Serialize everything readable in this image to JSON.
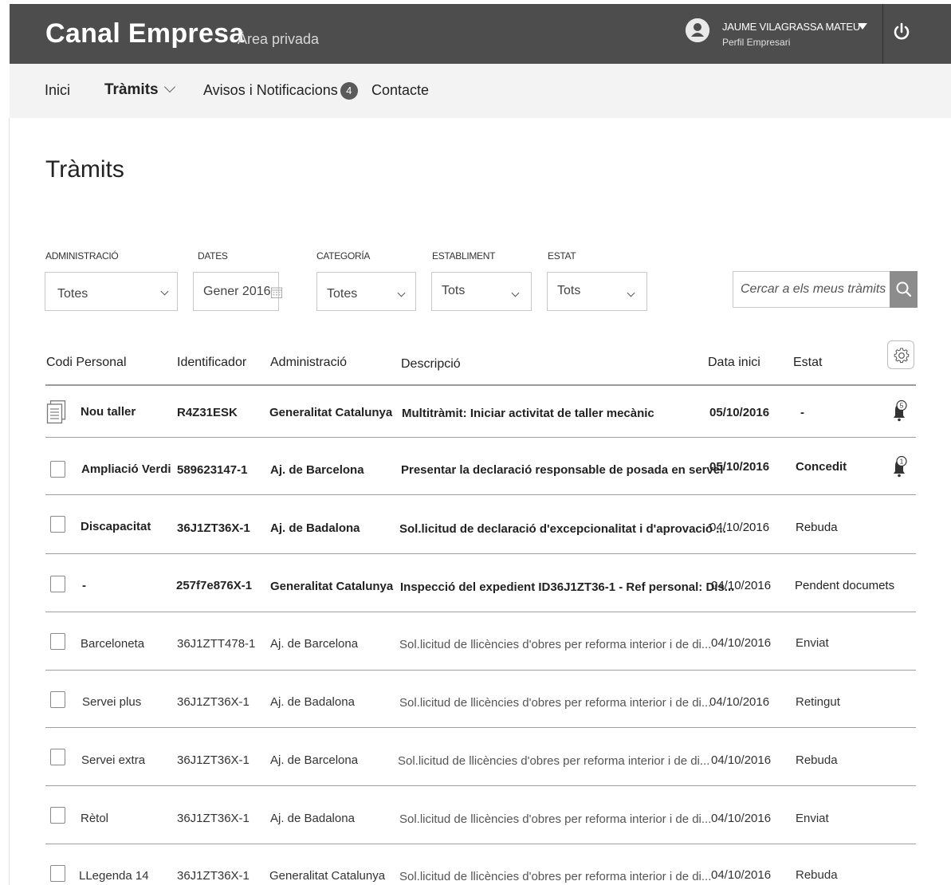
{
  "header": {
    "brand": "Canal Empresa",
    "subtitle": "Àrea privada",
    "user_name": "JAUME VILAGRASSA MATEU",
    "user_profile": "Perfil Empresari"
  },
  "nav": {
    "items": [
      {
        "label": "Inici"
      },
      {
        "label": "Tràmits"
      },
      {
        "label": "Avisos i Notificacions",
        "badge": "4"
      },
      {
        "label": "Contacte"
      }
    ]
  },
  "page_title": "Tràmits",
  "filters": {
    "administracio": {
      "label": "ADMINISTRACIÓ",
      "value": "Totes"
    },
    "dates": {
      "label": "DATES",
      "value": "Gener 2016"
    },
    "categoria": {
      "label": "CATEGORÍA",
      "value": "Totes"
    },
    "establiment": {
      "label": "ESTABLIMENT",
      "value": "Tots"
    },
    "estat": {
      "label": "ESTAT",
      "value": "Tots"
    },
    "search_placeholder": "Cercar a els meus tràmits"
  },
  "table": {
    "columns": [
      "Codi Personal",
      "Identificador",
      "Administració",
      "Descripció",
      "Data inici",
      "Estat"
    ],
    "rows": [
      {
        "codi": "Nou taller",
        "id": "R4Z31ESK",
        "admin": "Generalitat Catalunya",
        "desc": "Multitràmit: Iniciar activitat de taller mecànic",
        "date": "05/10/2016",
        "estat": "-",
        "bell": "5"
      },
      {
        "codi": "Ampliació Verdi",
        "id": "589623147-1",
        "admin": "Aj. de Barcelona",
        "desc": "Presentar la declaració responsable de posada en servei",
        "date": "05/10/2016",
        "estat": "Concedit",
        "bell": "1"
      },
      {
        "codi": "Discapacitat",
        "id": "36J1ZT36X-1",
        "admin": "Aj. de Badalona",
        "desc": "Sol.licitud de declaració d'excepcionalitat i d'aprovació ...",
        "date": "04/10/2016",
        "estat": "Rebuda"
      },
      {
        "codi": "-",
        "id": "257f7e876X-1",
        "admin": "Generalitat Catalunya",
        "desc": "Inspecció del expedient ID36J1ZT36-1 - Ref personal: Dis...",
        "date": "04/10/2016",
        "estat": "Pendent documets"
      },
      {
        "codi": "Barceloneta",
        "id": "36J1ZTT478-1",
        "admin": "Aj. de Barcelona",
        "desc": "Sol.licitud de llicències d'obres per reforma interior i de di...",
        "date": "04/10/2016",
        "estat": "Enviat"
      },
      {
        "codi": "Servei plus",
        "id": "36J1ZT36X-1",
        "admin": "Aj. de Badalona",
        "desc": "Sol.licitud de llicències d'obres per reforma interior i de di...",
        "date": "04/10/2016",
        "estat": "Retingut"
      },
      {
        "codi": "Servei extra",
        "id": "36J1ZT36X-1",
        "admin": "Aj. de Barcelona",
        "desc": "Sol.licitud de llicències d'obres per reforma interior i de di...",
        "date": "04/10/2016",
        "estat": "Rebuda"
      },
      {
        "codi": "Rètol",
        "id": "36J1ZT36X-1",
        "admin": "Aj. de Badalona",
        "desc": "Sol.licitud de llicències d'obres per reforma interior i de di...",
        "date": "04/10/2016",
        "estat": "Enviat"
      },
      {
        "codi": "LLegenda 14",
        "id": "36J1ZT36X-1",
        "admin": "Generalitat Catalunya",
        "desc": "Sol.licitud de llicències d'obres per reforma interior i de di...",
        "date": "04/10/2016",
        "estat": "Rebuda"
      }
    ]
  }
}
